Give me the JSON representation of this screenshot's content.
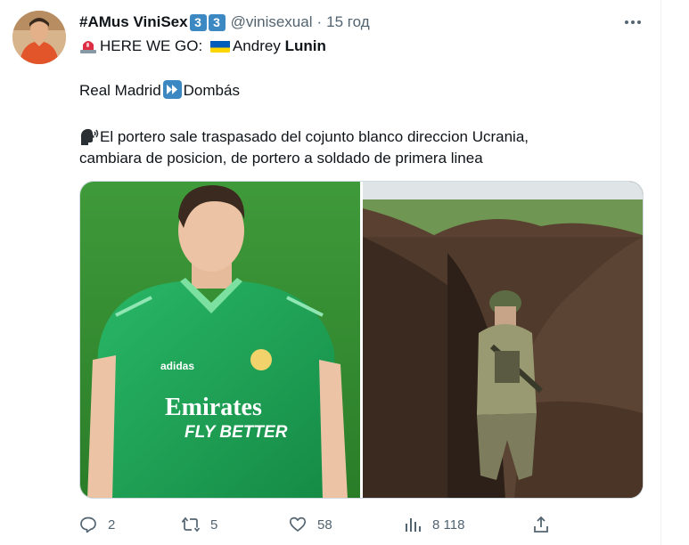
{
  "tweet": {
    "display_name": "#AMus ViniSex",
    "badges": [
      "3",
      "3"
    ],
    "handle": "@vinisexual",
    "separator": "·",
    "time": "15 год",
    "line1_prefix": "HERE WE GO: ",
    "line1_name": "Andrey ",
    "line1_bold": "Lunin",
    "line2_left": "Real Madrid",
    "line2_right": "Dombás",
    "line3": "El portero sale traspasado del cojunto blanco direccion Ucrania,",
    "line4": "cambiara de posicion, de portero a soldado de primera linea"
  },
  "images": {
    "left_alt": "Goalkeeper in green Real Madrid Emirates Fly Better kit",
    "right_alt": "Soldier standing in a trench in a field",
    "jersey_sponsor_1": "Emirates",
    "jersey_sponsor_2": "FLY BETTER",
    "jersey_brand": "adidas"
  },
  "actions": {
    "replies": "2",
    "retweets": "5",
    "likes": "58",
    "views": "8 118"
  },
  "colors": {
    "text": "#0f1419",
    "muted": "#536471",
    "badge": "#3b88c3",
    "jersey": "#1fa35a",
    "pitch": "#2f8a2c"
  }
}
